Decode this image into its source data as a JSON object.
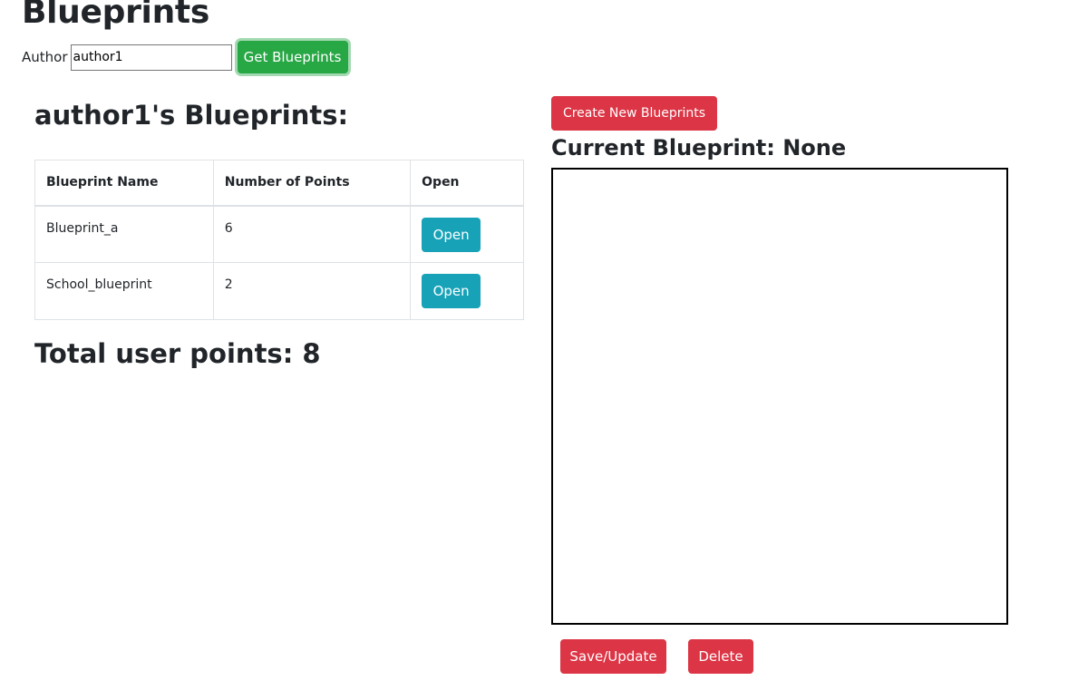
{
  "page": {
    "title": "Blueprints"
  },
  "author_form": {
    "label": "Author",
    "input_value": "author1",
    "get_button_label": "Get Blueprints"
  },
  "blueprints_section": {
    "title": "author1's Blueprints:",
    "table": {
      "headers": [
        "Blueprint Name",
        "Number of Points",
        "Open"
      ],
      "rows": [
        {
          "name": "Blueprint_a",
          "points": "6",
          "open_label": "Open"
        },
        {
          "name": "School_blueprint",
          "points": "2",
          "open_label": "Open"
        }
      ]
    },
    "total_points": "Total user points: 8"
  },
  "editor": {
    "create_button_label": "Create New Blueprints",
    "current_title": "Current Blueprint: None",
    "save_button_label": "Save/Update",
    "delete_button_label": "Delete"
  },
  "colors": {
    "success": "#28a745",
    "info": "#17a2b8",
    "danger": "#dc3545",
    "text": "#212529",
    "border": "#dee2e6"
  }
}
